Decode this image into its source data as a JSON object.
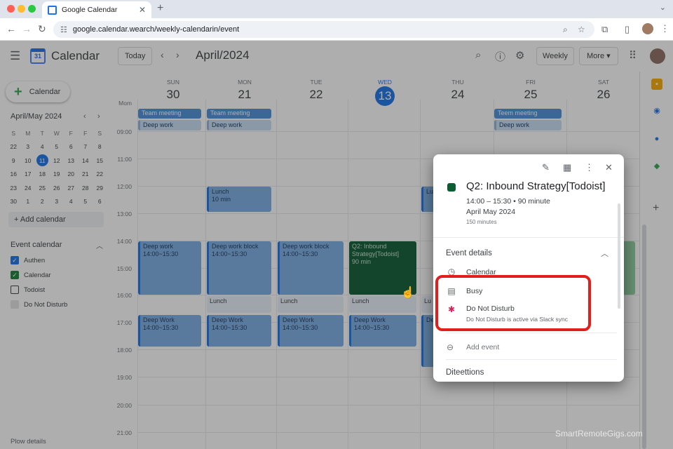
{
  "browser": {
    "tab_title": "Google Calendar",
    "tab_close": "✕",
    "new_tab": "+",
    "tab_menu": "⌄",
    "url": "google.calendar.wearch/weekly-calendarin/event",
    "icons": [
      "back-arrow-icon",
      "forward-arrow-icon",
      "reload-icon",
      "tune-icon",
      "zoom-icon",
      "star-icon",
      "extensions-icon",
      "sidebar-icon",
      "kebab-icon"
    ]
  },
  "header": {
    "app_title": "Calendar",
    "today_label": "Today",
    "month_label": "April/2024",
    "view_label": "Weekly",
    "more_label": "More ▾",
    "logo_text": "31"
  },
  "sidebar": {
    "create_label": "Calendar",
    "mini_title": "April/May 2024",
    "mini_headers": [
      "S",
      "M",
      "T",
      "W",
      "F",
      "F",
      "S"
    ],
    "mini_days": [
      [
        "22",
        "3",
        "4",
        "5",
        "6",
        "7",
        "8"
      ],
      [
        "9",
        "10",
        "11",
        "12",
        "13",
        "14",
        "15"
      ],
      [
        "16",
        "17",
        "18",
        "19",
        "20",
        "21",
        "22"
      ],
      [
        "23",
        "24",
        "25",
        "26",
        "27",
        "28",
        "29"
      ],
      [
        "30",
        "1",
        "2",
        "3",
        "4",
        "5",
        "6"
      ]
    ],
    "mini_today": "11",
    "add_calendar": "+ Add calendar",
    "event_calendar_title": "Event calendar",
    "calendars": [
      {
        "label": "Authen",
        "color": "#1a73e8",
        "checked": true
      },
      {
        "label": "Calendar",
        "color": "#188038",
        "checked": true
      },
      {
        "label": "Todoist",
        "color": "#3c4043",
        "checked": false
      },
      {
        "label": "Do Not Disturb",
        "color": "#c4c7c5",
        "checked": false
      }
    ],
    "flow_details": "Plow details"
  },
  "week": {
    "allday_label": "Mom",
    "days": [
      {
        "name": "SUN",
        "num": "30"
      },
      {
        "name": "MON",
        "num": "21"
      },
      {
        "name": "TUE",
        "num": "22"
      },
      {
        "name": "WED",
        "num": "13",
        "today": true
      },
      {
        "name": "THU",
        "num": "24"
      },
      {
        "name": "FRI",
        "num": "25"
      },
      {
        "name": "SAT",
        "num": "26"
      }
    ],
    "hours": [
      "09:00",
      "11:00",
      "12:00",
      "13:00",
      "14:00",
      "15:00",
      "16:00",
      "17:00",
      "18:00",
      "19:00",
      "20:00",
      "21:00"
    ],
    "events": {
      "sun_team": "Team meeting",
      "sun_deep": "Deep work",
      "mon_team": "Team meeting",
      "mon_deep": "Deep work",
      "fri_team": "Teem meeting",
      "fri_deep": "Deep work",
      "mon_lunch_title": "Lunch",
      "mon_lunch_time": "10 min",
      "thu_lunch_title": "Lu",
      "sun_dw_title": "Deep work",
      "sun_dw_time": "14:00~15:30",
      "mon_dwb_title": "Deep work block",
      "mon_dwb_time": "14:00~15:30",
      "tue_dwb_title": "Deep work block",
      "tue_dwb_time": "14:00~15:30",
      "wed_q2_title": "Q2: Inbound Strategy[Todoist]",
      "wed_q2_time": "90 min",
      "mon_lunch2": "Lunch",
      "tue_lunch2": "Lunch",
      "wed_lunch2": "Lunch",
      "thu_lunch2": "Lu",
      "sun_dw2_title": "Deep Work",
      "sun_dw2_time": "14:00~15:30",
      "mon_dw2_title": "Deep Work",
      "mon_dw2_time": "14:00~15:30",
      "tue_dw2_title": "Deep Work",
      "tue_dw2_time": "14:00~15:30",
      "wed_dw2_title": "Deep Work",
      "wed_dw2_time": "14:00~15:30",
      "thu_dw2_title": "De"
    }
  },
  "popup": {
    "title": "Q2: Inbound Strategy[Todoist]",
    "time": "14:00 – 15:30 • 90 minute",
    "date": "April May 2024",
    "duration": "150 minutes",
    "details_title": "Event details",
    "row_calendar": "Calendar",
    "row_busy": "Busy",
    "row_dnd": "Do Not Disturb",
    "row_dnd_sub": "Do Not Disturb is active via Slack sync",
    "add_event": "Add event",
    "bottom_section": "Diteettions",
    "color": "#0b5c33"
  },
  "highlight_color": "#e0201c",
  "watermark": "SmartRemoteGigs.com"
}
